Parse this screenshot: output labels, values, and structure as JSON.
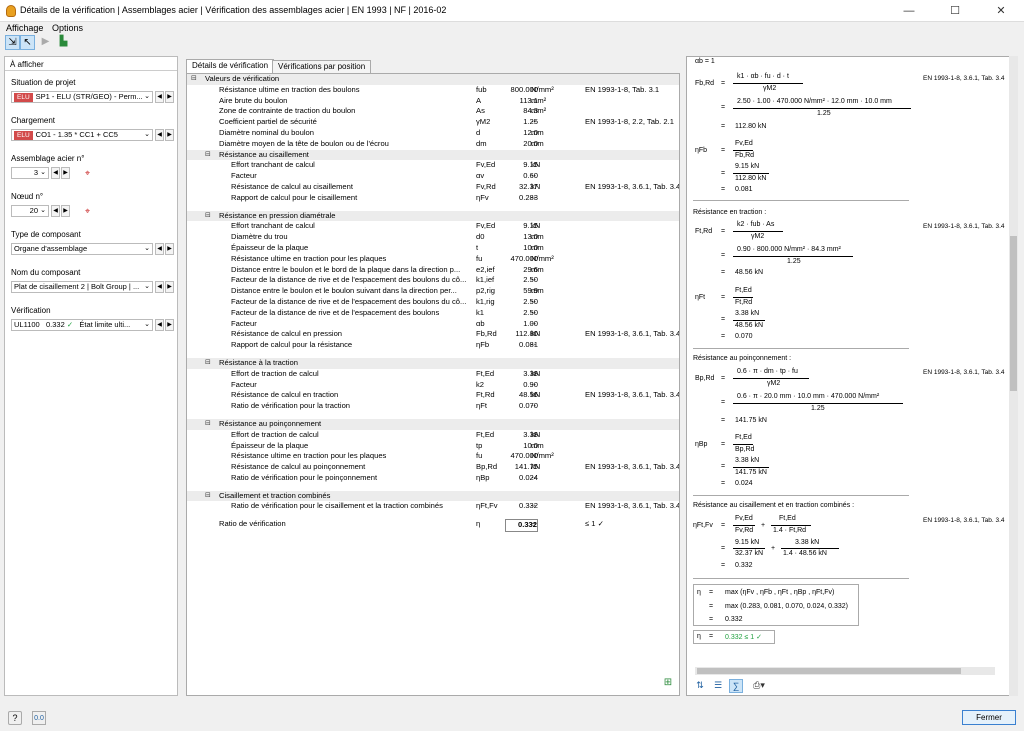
{
  "window": {
    "title": "Détails de la vérification | Assemblages acier | Vérification des assemblages acier | EN 1993 | NF | 2016-02",
    "min": "—",
    "max": "☐",
    "close": "✕"
  },
  "menu": {
    "affichage": "Affichage",
    "options": "Options"
  },
  "left": {
    "header": "À afficher",
    "situation_label": "Situation de projet",
    "situation_badge": "ELU",
    "situation_value": "SP1 - ELU (STR/GEO) - Perm...",
    "chargement_label": "Chargement",
    "chargement_badge": "ELU",
    "chargement_value": "CO1 - 1.35 * CC1 + CC5",
    "assemblage_label": "Assemblage acier n°",
    "assemblage_value": "3",
    "noeud_label": "Nœud n°",
    "noeud_value": "20",
    "type_label": "Type de composant",
    "type_value": "Organe d'assemblage",
    "nom_label": "Nom du composant",
    "nom_value": "Plat de cisaillement 2 | Bolt Group | ...",
    "verif_label": "Vérification",
    "verif_id": "UL1100",
    "verif_ratio": "0.332",
    "verif_check": "✓",
    "verif_state": "État limite ulti..."
  },
  "tabs": [
    "Détails de vérification",
    "Vérifications par position"
  ],
  "rows": [
    {
      "k": "s",
      "t": "Valeurs de vérification",
      "lv": 0
    },
    {
      "t": "Résistance ultime en traction des boulons",
      "s": "fub",
      "v": "800.000",
      "u": "N/mm²",
      "n": "EN 1993-1-8, Tab. 3.1",
      "lv": 1
    },
    {
      "t": "Aire brute du boulon",
      "s": "A",
      "v": "113.1",
      "u": "mm²",
      "lv": 1
    },
    {
      "t": "Zone de contrainte de traction du boulon",
      "s": "As",
      "v": "84.3",
      "u": "mm²",
      "lv": 1
    },
    {
      "t": "Coefficient partiel de sécurité",
      "s": "γM2",
      "v": "1.25",
      "u": "--",
      "n": "EN 1993-1-8, 2.2, Tab. 2.1",
      "lv": 1
    },
    {
      "t": "Diamètre nominal du boulon",
      "s": "d",
      "v": "12.0",
      "u": "mm",
      "lv": 1
    },
    {
      "t": "Diamètre moyen de la tête de boulon ou de l'écrou",
      "s": "dm",
      "v": "20.0",
      "u": "mm",
      "lv": 1
    },
    {
      "k": "s",
      "t": "Résistance au cisaillement",
      "lv": 1
    },
    {
      "t": "Effort tranchant de calcul",
      "s": "Fv,Ed",
      "v": "9.15",
      "u": "kN",
      "lv": 2
    },
    {
      "t": "Facteur",
      "s": "αv",
      "v": "0.60",
      "u": "--",
      "lv": 2
    },
    {
      "t": "Résistance de calcul au cisaillement",
      "s": "Fv,Rd",
      "v": "32.37",
      "u": "kN",
      "n": "EN 1993-1-8, 3.6.1, Tab. 3.4",
      "lv": 2
    },
    {
      "t": "Rapport de calcul pour le cisaillement",
      "s": "ηFv",
      "v": "0.283",
      "u": "--",
      "lv": 2
    },
    {
      "k": "g"
    },
    {
      "k": "s",
      "t": "Résistance en pression diamétrale",
      "lv": 1
    },
    {
      "t": "Effort tranchant de calcul",
      "s": "Fv,Ed",
      "v": "9.15",
      "u": "kN",
      "lv": 2
    },
    {
      "t": "Diamètre du trou",
      "s": "d0",
      "v": "13.0",
      "u": "mm",
      "lv": 2
    },
    {
      "t": "Épaisseur de la plaque",
      "s": "t",
      "v": "10.0",
      "u": "mm",
      "lv": 2
    },
    {
      "t": "Résistance ultime en traction pour les plaques",
      "s": "fu",
      "v": "470.000",
      "u": "N/mm²",
      "lv": 2
    },
    {
      "t": "Distance entre le boulon et le bord de la plaque dans la direction p...",
      "s": "e2,ief",
      "v": "29.6",
      "u": "mm",
      "lv": 2
    },
    {
      "t": "Facteur de la distance de rive et de l'espacement des boulons du cô...",
      "s": "k1,ief",
      "v": "2.50",
      "u": "--",
      "lv": 2
    },
    {
      "t": "Distance entre le boulon et le boulon suivant dans la direction per...",
      "s": "p2,rig",
      "v": "59.9",
      "u": "mm",
      "lv": 2
    },
    {
      "t": "Facteur de la distance de rive et de l'espacement des boulons du cô...",
      "s": "k1,rig",
      "v": "2.50",
      "u": "--",
      "lv": 2
    },
    {
      "t": "Facteur de la distance de rive et de l'espacement des boulons",
      "s": "k1",
      "v": "2.50",
      "u": "--",
      "lv": 2
    },
    {
      "t": "Facteur",
      "s": "αb",
      "v": "1.00",
      "u": "--",
      "lv": 2
    },
    {
      "t": "Résistance de calcul en pression",
      "s": "Fb,Rd",
      "v": "112.80",
      "u": "kN",
      "n": "EN 1993-1-8, 3.6.1, Tab. 3.4",
      "lv": 2
    },
    {
      "t": "Rapport de calcul pour la résistance",
      "s": "ηFb",
      "v": "0.081",
      "u": "--",
      "lv": 2
    },
    {
      "k": "g"
    },
    {
      "k": "s",
      "t": "Résistance à la traction",
      "lv": 1
    },
    {
      "t": "Effort de traction de calcul",
      "s": "Ft,Ed",
      "v": "3.38",
      "u": "kN",
      "lv": 2
    },
    {
      "t": "Facteur",
      "s": "k2",
      "v": "0.90",
      "u": "--",
      "lv": 2
    },
    {
      "t": "Résistance de calcul en traction",
      "s": "Ft,Rd",
      "v": "48.56",
      "u": "kN",
      "n": "EN 1993-1-8, 3.6.1, Tab. 3.4",
      "lv": 2
    },
    {
      "t": "Ratio de vérification pour la traction",
      "s": "ηFt",
      "v": "0.070",
      "u": "--",
      "lv": 2
    },
    {
      "k": "g"
    },
    {
      "k": "s",
      "t": "Résistance au poinçonnement",
      "lv": 1
    },
    {
      "t": "Effort de traction de calcul",
      "s": "Ft,Ed",
      "v": "3.38",
      "u": "kN",
      "lv": 2
    },
    {
      "t": "Épaisseur de la plaque",
      "s": "tp",
      "v": "10.0",
      "u": "mm",
      "lv": 2
    },
    {
      "t": "Résistance ultime en traction pour les plaques",
      "s": "fu",
      "v": "470.000",
      "u": "N/mm²",
      "lv": 2
    },
    {
      "t": "Résistance de calcul au poinçonnement",
      "s": "Bp,Rd",
      "v": "141.75",
      "u": "kN",
      "n": "EN 1993-1-8, 3.6.1, Tab. 3.4",
      "lv": 2
    },
    {
      "t": "Ratio de vérification pour le poinçonnement",
      "s": "ηBp",
      "v": "0.024",
      "u": "--",
      "lv": 2
    },
    {
      "k": "g"
    },
    {
      "k": "s",
      "t": "Cisaillement et traction combinés",
      "lv": 1
    },
    {
      "t": "Ratio de vérification pour le cisaillement et la traction combinés",
      "s": "ηFt,Fv",
      "v": "0.332",
      "u": "--",
      "n": "EN 1993-1-8, 3.6.1, Tab. 3.4",
      "lv": 2
    },
    {
      "k": "g"
    },
    {
      "t": "Ratio de vérification",
      "s": "η",
      "v": "0.332",
      "u": "--",
      "n": "≤ 1 ✓",
      "lv": 1,
      "box": true
    }
  ],
  "right": {
    "fbrd_sym": "Fb,Rd",
    "fbrd_num": "k1 · αb · fu · d · t",
    "fbrd_den": "γM2",
    "fbrd_num2": "2.50 · 1.00 · 470.000 N/mm² · 12.0 mm · 10.0 mm",
    "fbrd_den2": "1.25",
    "fbrd_res": "112.80 kN",
    "fbrd_ref": "EN 1993-1-8, 3.6.1, Tab. 3.4",
    "etafb_sym": "ηFb",
    "etafb_num": "Fv,Ed",
    "etafb_den": "Fb,Rd",
    "etafb_num2": "9.15 kN",
    "etafb_den2": "112.80 kN",
    "etafb_res": "0.081",
    "tr_title": "Résistance en traction :",
    "ftrd_sym": "Ft,Rd",
    "ftrd_num": "k2 · fub · As",
    "ftrd_den": "γM2",
    "ftrd_num2": "0.90 · 800.000 N/mm² · 84.3 mm²",
    "ftrd_den2": "1.25",
    "ftrd_res": "48.56 kN",
    "ftrd_ref": "EN 1993-1-8, 3.6.1, Tab. 3.4",
    "etaft_sym": "ηFt",
    "etaft_num": "Ft,Ed",
    "etaft_den": "Ft,Rd",
    "etaft_num2": "3.38 kN",
    "etaft_den2": "48.56 kN",
    "etaft_res": "0.070",
    "po_title": "Résistance au poinçonnement :",
    "bprd_sym": "Bp,Rd",
    "bprd_num": "0.6 · π · dm · tp · fu",
    "bprd_den": "γM2",
    "bprd_num2": "0.6 · π · 20.0 mm · 10.0 mm · 470.000 N/mm²",
    "bprd_den2": "1.25",
    "bprd_res": "141.75 kN",
    "bprd_ref": "EN 1993-1-8, 3.6.1, Tab. 3.4",
    "etabp_sym": "ηBp",
    "etabp_num": "Ft,Ed",
    "etabp_den": "Bp,Rd",
    "etabp_num2": "3.38 kN",
    "etabp_den2": "141.75 kN",
    "etabp_res": "0.024",
    "co_title": "Résistance au cisaillement et en traction combinés :",
    "etaco_sym": "ηFt,Fv",
    "etaco_a_num": "Fv,Ed",
    "etaco_a_den": "Fv,Rd",
    "etaco_b_num": "Ft,Ed",
    "etaco_b_den": "1.4 · Ft,Rd",
    "etaco_a_num2": "9.15 kN",
    "etaco_a_den2": "32.37 kN",
    "etaco_b_num2": "3.38 kN",
    "etaco_b_den2": "1.4 · 48.56 kN",
    "etaco_res": "0.332",
    "etaco_ref": "EN 1993-1-8, 3.6.1, Tab. 3.4",
    "max_sym": "η",
    "max_expr": "max (ηFv , ηFb , ηFt , ηBp , ηFt,Fv)",
    "max_vals": "max (0.283, 0.081, 0.070, 0.024, 0.332)",
    "max_res": "0.332",
    "final": "0.332  ≤ 1 ✓",
    "eq": "=",
    "plus": "+",
    "ab": "αb  =  1"
  },
  "buttons": {
    "fermer": "Fermer"
  }
}
